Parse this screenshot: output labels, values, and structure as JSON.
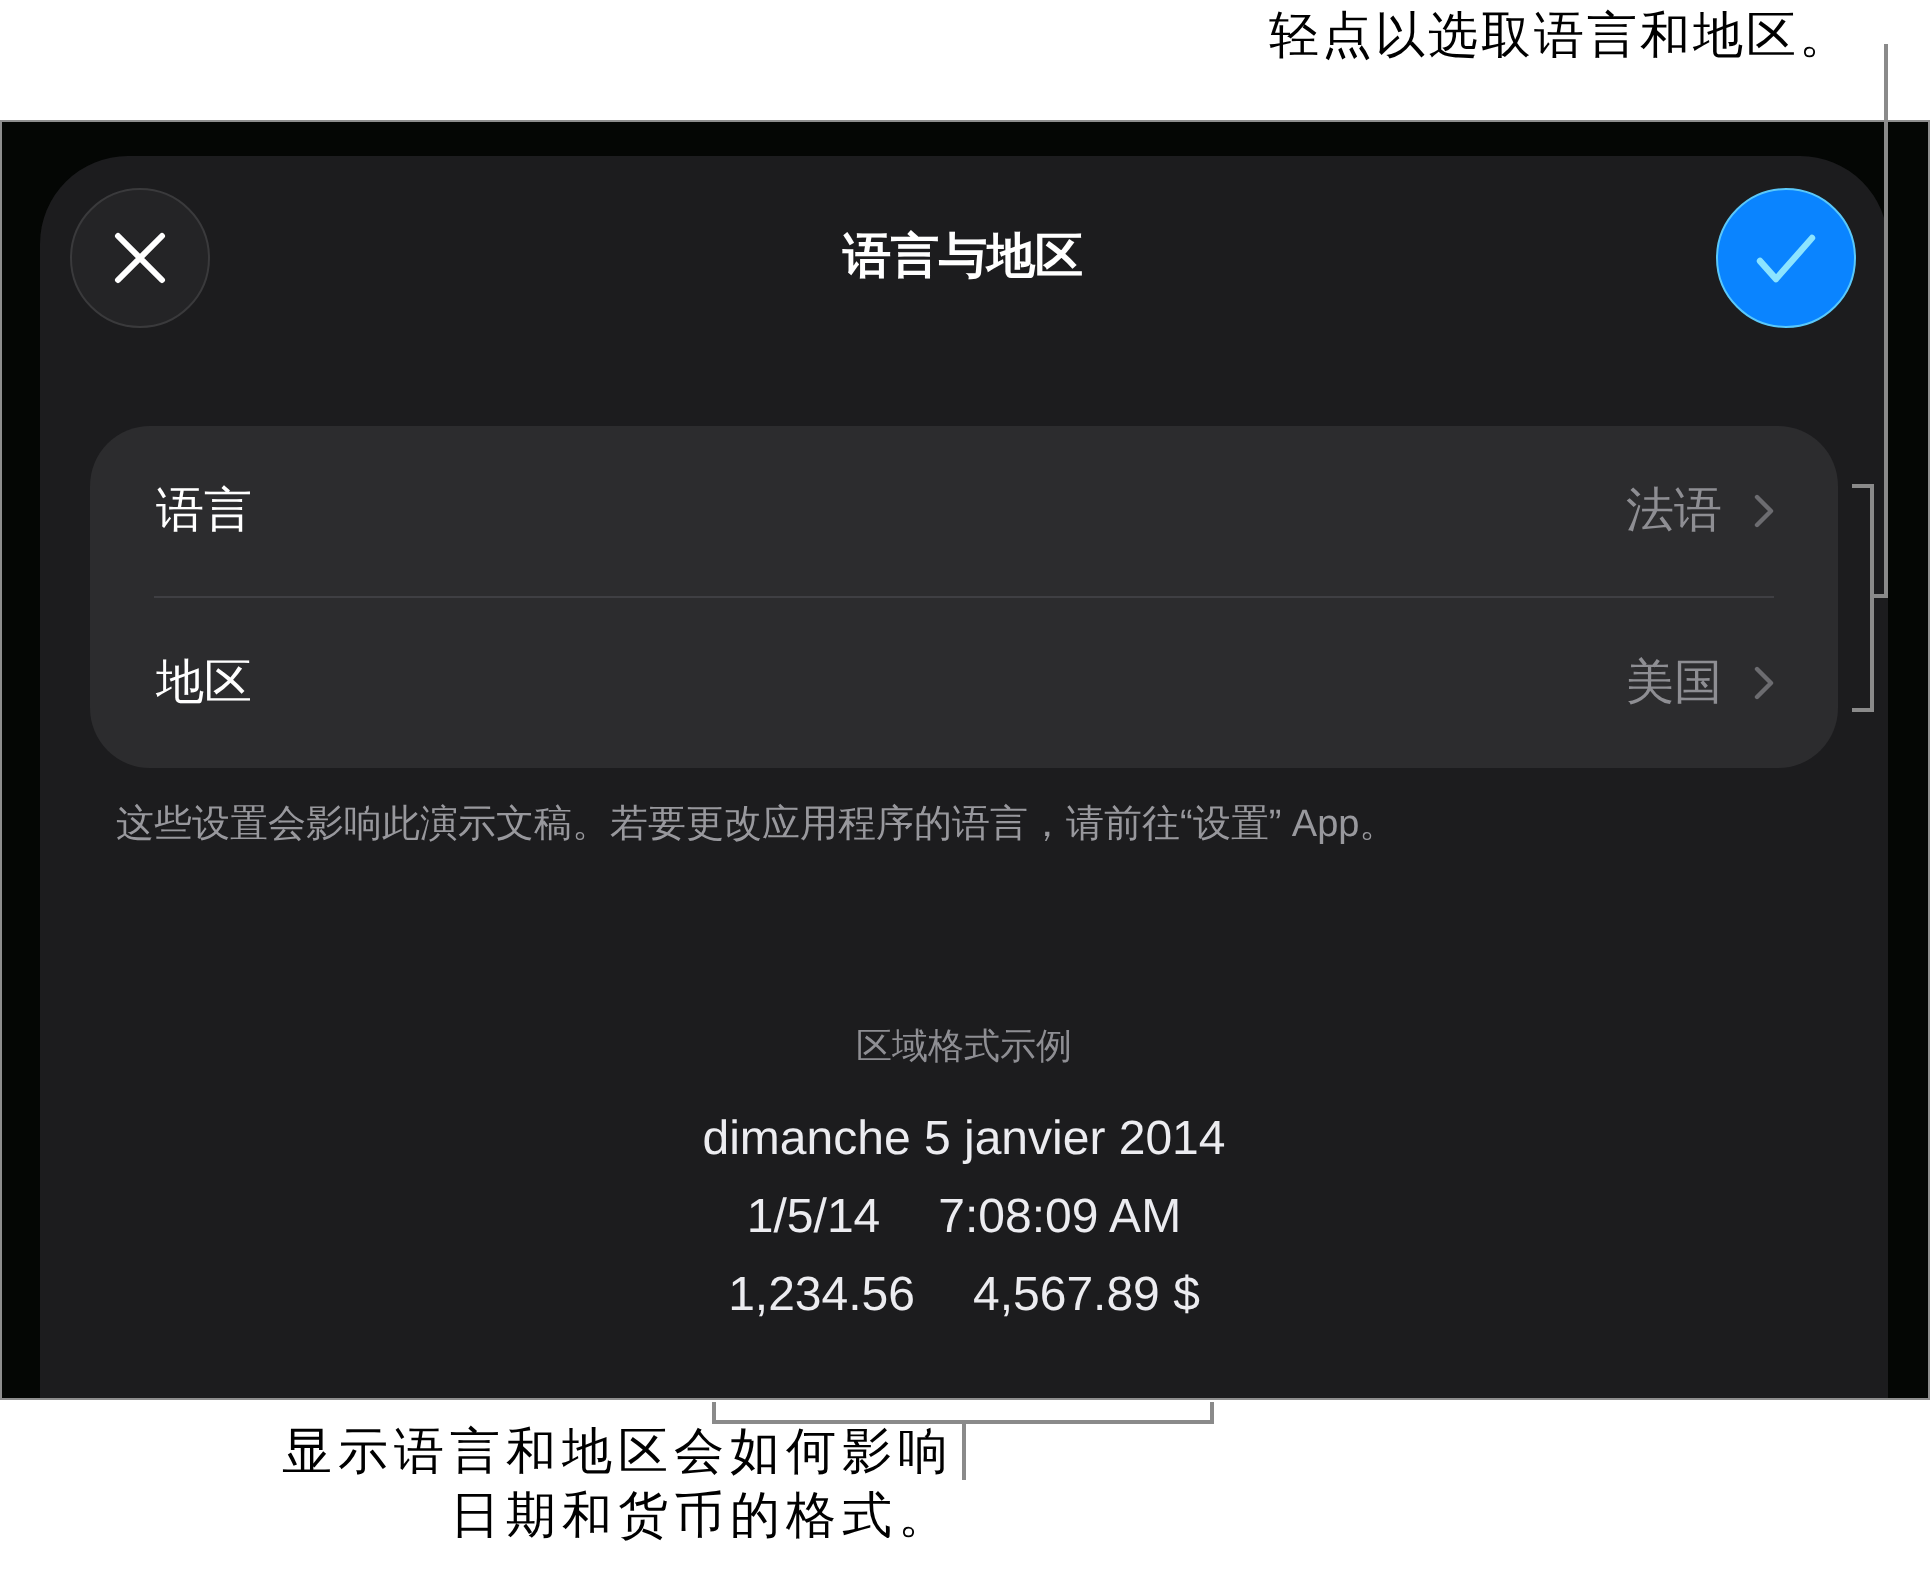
{
  "top_callout": "轻点以选取语言和地区。",
  "sheet": {
    "title": "语言与地区",
    "settings": [
      {
        "label": "语言",
        "value": "法语"
      },
      {
        "label": "地区",
        "value": "美国"
      }
    ],
    "note": "这些设置会影响此演示文稿。若要更改应用程序的语言，请前往“设置” App。",
    "format_example": {
      "heading": "区域格式示例",
      "lines": [
        {
          "parts": [
            "dimanche 5 janvier 2014"
          ]
        },
        {
          "parts": [
            "1/5/14",
            "7:08:09 AM"
          ]
        },
        {
          "parts": [
            "1,234.56",
            "4,567.89 $"
          ]
        }
      ]
    }
  },
  "bottom_callout": "显示语言和地区会如何影响日期和货币的格式。"
}
